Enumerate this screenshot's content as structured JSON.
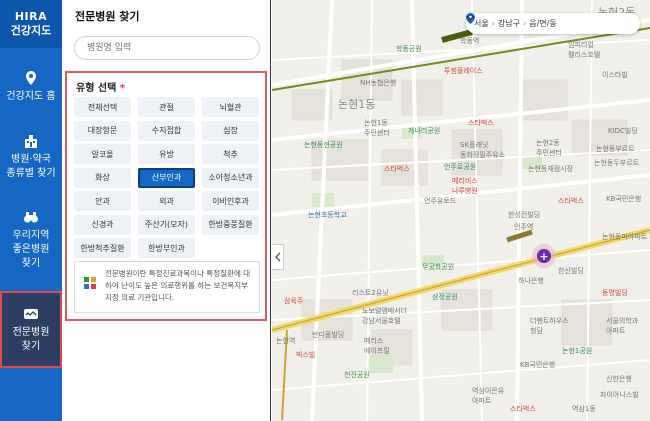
{
  "nav": {
    "logo_line1": "HIRA",
    "logo_line2": "건강지도",
    "items": [
      {
        "label": "건강지도 홈"
      },
      {
        "label": "병원·약국\n종류별 찾기"
      },
      {
        "label": "우리지역\n좋은병원\n찾기"
      },
      {
        "label": "전문병원\n찾기"
      }
    ]
  },
  "panel": {
    "title": "전문병원 찾기",
    "search_placeholder": "병원명 입력",
    "type_heading": "유형 선택",
    "required_mark": "*",
    "types": [
      "전체선택",
      "관절",
      "뇌혈관",
      "대장항문",
      "수지접합",
      "심장",
      "알코올",
      "유방",
      "척추",
      "화상",
      "산부인과",
      "소아청소년과",
      "안과",
      "외과",
      "이비인후과",
      "신경과",
      "주산기(모자)",
      "한방중풍질환",
      "한방척추질환",
      "한방부인과"
    ],
    "selected_type": "산부인과",
    "info_text": "전문병원이란 특정진료과목이나 특정질환에 대하여 난이도 높은 의료행위를 하는 보건복지부 지정 의료 기관입니다."
  },
  "location": {
    "city": "서울",
    "district": "강남구",
    "dong": "읍/면/동"
  },
  "map_labels": [
    {
      "text": "논현1동",
      "kind": "big"
    },
    {
      "text": "논현2동",
      "kind": "big"
    },
    {
      "text": "학동역",
      "kind": "grey"
    },
    {
      "text": "논현역",
      "kind": "grey"
    },
    {
      "text": "언주역",
      "kind": "grey"
    },
    {
      "text": "NH농협은행",
      "kind": "grey"
    },
    {
      "text": "투썸플레이스",
      "kind": "red"
    },
    {
      "text": "학동공원",
      "kind": "green"
    },
    {
      "text": "임피리얼\n팰리스호텔",
      "kind": "grey"
    },
    {
      "text": "이스타빌",
      "kind": "grey"
    },
    {
      "text": "논현1동\n주민센터",
      "kind": "grey"
    },
    {
      "text": "게나리공원",
      "kind": "green"
    },
    {
      "text": "스타벅스",
      "kind": "red"
    },
    {
      "text": "KIDC빌딩",
      "kind": "grey"
    },
    {
      "text": "논현동현공원",
      "kind": "green"
    },
    {
      "text": "SK플래닛\n동화정밀주유소",
      "kind": "grey"
    },
    {
      "text": "논현2동\n주민센터",
      "kind": "grey"
    },
    {
      "text": "논현동부르트",
      "kind": "grey"
    },
    {
      "text": "논현동두부르트",
      "kind": "grey"
    },
    {
      "text": "논현동재점시장",
      "kind": "grey"
    },
    {
      "text": "스타벅스",
      "kind": "red"
    },
    {
      "text": "언주로공원",
      "kind": "green"
    },
    {
      "text": "논현초등학교",
      "kind": "blue"
    },
    {
      "text": "언주유토드",
      "kind": "grey"
    },
    {
      "text": "메리비스\n나루병원",
      "kind": "red"
    },
    {
      "text": "KB국민은행",
      "kind": "grey"
    },
    {
      "text": "한성컨빌딩",
      "kind": "grey"
    },
    {
      "text": "스타벅스",
      "kind": "red"
    },
    {
      "text": "무궁화공원",
      "kind": "green"
    },
    {
      "text": "하나은행",
      "kind": "grey"
    },
    {
      "text": "한신빌딩",
      "kind": "grey"
    },
    {
      "text": "리스트2유닛",
      "kind": "grey"
    },
    {
      "text": "삼정공원",
      "kind": "green"
    },
    {
      "text": "삼육주",
      "kind": "red"
    },
    {
      "text": "노보텔앰배서더\n강남서울호텔",
      "kind": "grey"
    },
    {
      "text": "동명빌딩",
      "kind": "red"
    },
    {
      "text": "반디폴빌딩",
      "kind": "grey"
    },
    {
      "text": "빅스빌",
      "kind": "red"
    },
    {
      "text": "메리스\n에이프릴",
      "kind": "grey"
    },
    {
      "text": "천진공원",
      "kind": "green"
    },
    {
      "text": "더펜트하우스\n청담",
      "kind": "grey"
    },
    {
      "text": "논현1공원",
      "kind": "green"
    },
    {
      "text": "KB국민은행",
      "kind": "grey"
    },
    {
      "text": "역삼이은유\n아파트",
      "kind": "grey"
    },
    {
      "text": "스타벅스",
      "kind": "red"
    },
    {
      "text": "자이아니스빌",
      "kind": "grey"
    },
    {
      "text": "역삼1동",
      "kind": "grey"
    },
    {
      "text": "신한은행",
      "kind": "grey"
    },
    {
      "text": "서울의학과\n아파트",
      "kind": "grey"
    },
    {
      "text": "논현동미아파트",
      "kind": "grey"
    }
  ],
  "colors": {
    "nav_bg": "#1667c4",
    "nav_active_bg": "#2c3f63",
    "highlight_red": "#e05a5a",
    "chip_selected": "#1667c4",
    "line_green": "#6e8b1c",
    "line_gold": "#c9a63a"
  }
}
